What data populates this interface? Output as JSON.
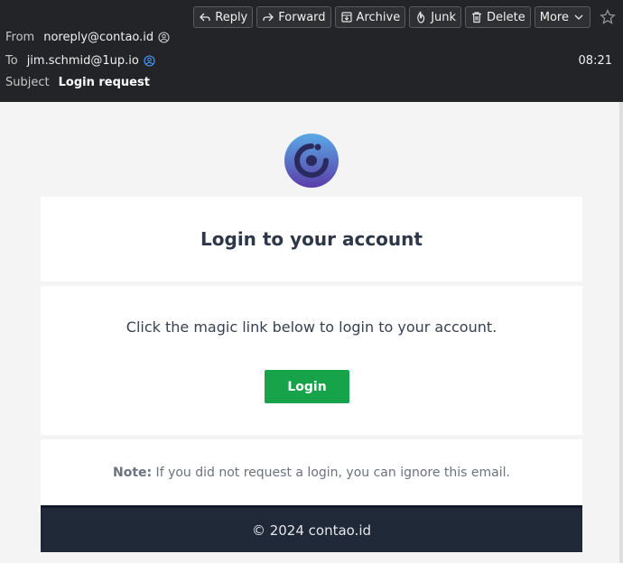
{
  "toolbar": {
    "reply": "Reply",
    "forward": "Forward",
    "archive": "Archive",
    "junk": "Junk",
    "delete": "Delete",
    "more": "More"
  },
  "header": {
    "from_label": "From",
    "from_value": "noreply@contao.id",
    "to_label": "To",
    "to_value": "jim.schmid@1up.io",
    "subject_label": "Subject",
    "subject_value": "Login request",
    "time": "08:21"
  },
  "email": {
    "heading": "Login to your account",
    "message": "Click the magic link below to login to your account.",
    "button": "Login",
    "note_label": "Note:",
    "note_text": " If you did not request a login, you can ignore this email.",
    "footer": "© 2024 contao.id"
  },
  "colors": {
    "header_bg": "#232427",
    "button_green": "#16a34a",
    "footer_bg": "#1f2937"
  }
}
